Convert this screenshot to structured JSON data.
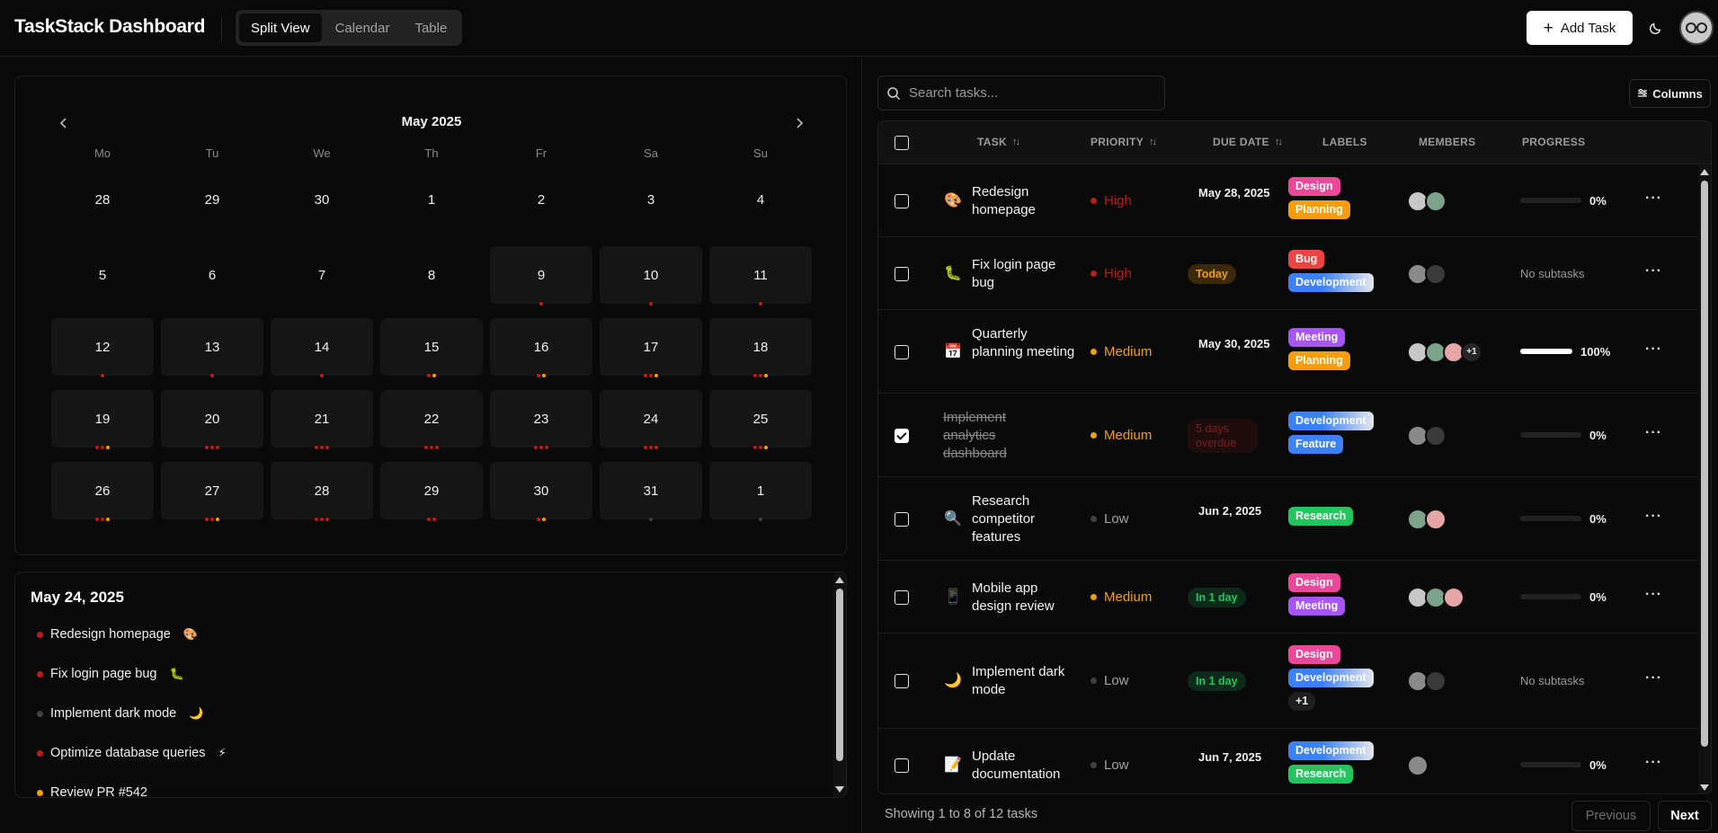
{
  "app": {
    "title": "TaskStack Dashboard"
  },
  "views": [
    "Split View",
    "Calendar",
    "Table"
  ],
  "active_view": "Split View",
  "header": {
    "add_task_label": "Add Task"
  },
  "colors": {
    "high": "#b91c1c",
    "medium": "#f59e0b",
    "low": "#3f3f46",
    "design": "#ec4899",
    "planning": "#f59e0b",
    "bug": "#ef4444",
    "development": "#3b82f6",
    "meeting": "#a855f7",
    "feature": "#3b82f6",
    "research": "#22c55e"
  },
  "calendar": {
    "month": "May 2025",
    "weekdays": [
      "Mo",
      "Tu",
      "We",
      "Th",
      "Fr",
      "Sa",
      "Su"
    ],
    "weeks": [
      [
        {
          "d": "28"
        },
        {
          "d": "29"
        },
        {
          "d": "30"
        },
        {
          "d": "1"
        },
        {
          "d": "2"
        },
        {
          "d": "3"
        },
        {
          "d": "4"
        }
      ],
      [
        {
          "d": "5"
        },
        {
          "d": "6"
        },
        {
          "d": "7"
        },
        {
          "d": "8"
        },
        {
          "d": "9",
          "bg": true,
          "dots": [
            "h"
          ]
        },
        {
          "d": "10",
          "bg": true,
          "dots": [
            "h"
          ]
        },
        {
          "d": "11",
          "bg": true,
          "dots": [
            "h"
          ]
        }
      ],
      [
        {
          "d": "12",
          "bg": true,
          "dots": [
            "h"
          ]
        },
        {
          "d": "13",
          "bg": true,
          "dots": [
            "h"
          ]
        },
        {
          "d": "14",
          "bg": true,
          "dots": [
            "h"
          ]
        },
        {
          "d": "15",
          "bg": true,
          "dots": [
            "h",
            "m"
          ]
        },
        {
          "d": "16",
          "bg": true,
          "dots": [
            "h",
            "m"
          ]
        },
        {
          "d": "17",
          "bg": true,
          "dots": [
            "h",
            "h",
            "m"
          ]
        },
        {
          "d": "18",
          "bg": true,
          "dots": [
            "h",
            "h",
            "m"
          ]
        }
      ],
      [
        {
          "d": "19",
          "bg": true,
          "dots": [
            "h",
            "h",
            "m"
          ]
        },
        {
          "d": "20",
          "bg": true,
          "dots": [
            "h",
            "h",
            "h"
          ]
        },
        {
          "d": "21",
          "bg": true,
          "dots": [
            "h",
            "h",
            "h"
          ]
        },
        {
          "d": "22",
          "bg": true,
          "dots": [
            "h",
            "h",
            "h"
          ]
        },
        {
          "d": "23",
          "bg": true,
          "dots": [
            "h",
            "h",
            "h"
          ]
        },
        {
          "d": "24",
          "bg": true,
          "dots": [
            "h",
            "h",
            "h"
          ]
        },
        {
          "d": "25",
          "bg": true,
          "dots": [
            "h",
            "h",
            "m"
          ]
        }
      ],
      [
        {
          "d": "26",
          "bg": true,
          "dots": [
            "h",
            "h",
            "m"
          ]
        },
        {
          "d": "27",
          "bg": true,
          "dots": [
            "h",
            "h",
            "m"
          ]
        },
        {
          "d": "28",
          "bg": true,
          "dots": [
            "h",
            "h",
            "h"
          ]
        },
        {
          "d": "29",
          "bg": true,
          "dots": [
            "h",
            "h"
          ]
        },
        {
          "d": "30",
          "bg": true,
          "dots": [
            "h",
            "m"
          ]
        },
        {
          "d": "31",
          "bg": true,
          "dots": [
            "l"
          ]
        },
        {
          "d": "1",
          "bg": true,
          "dots": [
            "l"
          ]
        }
      ]
    ]
  },
  "day_panel": {
    "date": "May 24, 2025",
    "items": [
      {
        "title": "Redesign homepage",
        "emoji": "🎨",
        "priority": "h"
      },
      {
        "title": "Fix login page bug",
        "emoji": "🐛",
        "priority": "h"
      },
      {
        "title": "Implement dark mode",
        "emoji": "🌙",
        "priority": "l"
      },
      {
        "title": "Optimize database queries",
        "emoji": "⚡",
        "priority": "h"
      },
      {
        "title": "Review PR #542",
        "emoji": "",
        "priority": "m"
      }
    ]
  },
  "table": {
    "search_placeholder": "Search tasks...",
    "columns_label": "Columns",
    "headers": {
      "task": "TASK",
      "priority": "PRIORITY",
      "due": "DUE DATE",
      "labels": "LABELS",
      "members": "MEMBERS",
      "progress": "PROGRESS"
    },
    "rows": [
      {
        "title": "Redesign homepage",
        "emoji": "🎨",
        "done": false,
        "priority": "High",
        "pk": "h",
        "due": "May 28, 2025",
        "due_type": "date",
        "labels": [
          [
            "Design",
            "design"
          ],
          [
            "Planning",
            "planning"
          ]
        ],
        "members": [
          "#c7c7c7",
          "#7ca38a"
        ],
        "more": "",
        "progress": 0,
        "progress_text": "0%"
      },
      {
        "title": "Fix login page bug",
        "emoji": "🐛",
        "done": false,
        "priority": "High",
        "pk": "h",
        "due": "Today",
        "due_type": "today",
        "labels": [
          [
            "Bug",
            "bug"
          ],
          [
            "Development",
            "development"
          ]
        ],
        "members": [
          "#8a8a8a",
          "#3a3a3a"
        ],
        "more": "",
        "progress": null,
        "progress_text": "No subtasks"
      },
      {
        "title": "Quarterly planning meeting",
        "emoji": "📅",
        "done": false,
        "priority": "Medium",
        "pk": "m",
        "due": "May 30, 2025",
        "due_type": "date",
        "labels": [
          [
            "Meeting",
            "meeting"
          ],
          [
            "Planning",
            "planning"
          ]
        ],
        "members": [
          "#c7c7c7",
          "#7ca38a",
          "#e6a6a6"
        ],
        "more": "+1",
        "progress": 1,
        "progress_text": "100%"
      },
      {
        "title": "Implement analytics dashboard",
        "emoji": "",
        "done": true,
        "priority": "Medium",
        "pk": "m",
        "due": "5 days overdue",
        "due_type": "overdue",
        "labels": [
          [
            "Development",
            "development"
          ],
          [
            "Feature",
            "feature"
          ]
        ],
        "members": [
          "#8a8a8a",
          "#3a3a3a"
        ],
        "more": "",
        "progress": 0,
        "progress_text": "0%"
      },
      {
        "title": "Research competitor features",
        "emoji": "🔍",
        "done": false,
        "priority": "Low",
        "pk": "l",
        "due": "Jun 2, 2025",
        "due_type": "date",
        "labels": [
          [
            "Research",
            "research"
          ]
        ],
        "members": [
          "#7ca38a",
          "#e6a6a6"
        ],
        "more": "",
        "progress": 0,
        "progress_text": "0%"
      },
      {
        "title": "Mobile app design review",
        "emoji": "📱",
        "done": false,
        "priority": "Medium",
        "pk": "m",
        "due": "In 1 day",
        "due_type": "soon",
        "labels": [
          [
            "Design",
            "design"
          ],
          [
            "Meeting",
            "meeting"
          ]
        ],
        "members": [
          "#c7c7c7",
          "#7ca38a",
          "#e6a6a6"
        ],
        "more": "",
        "progress": 0,
        "progress_text": "0%"
      },
      {
        "title": "Implement dark mode",
        "emoji": "🌙",
        "done": false,
        "priority": "Low",
        "pk": "l",
        "due": "In 1 day",
        "due_type": "soon",
        "labels": [
          [
            "Design",
            "design"
          ],
          [
            "Development",
            "development"
          ],
          [
            "+1",
            "more"
          ]
        ],
        "members": [
          "#8a8a8a",
          "#3a3a3a"
        ],
        "more": "",
        "progress": null,
        "progress_text": "No subtasks"
      },
      {
        "title": "Update documentation",
        "emoji": "📝",
        "done": false,
        "priority": "Low",
        "pk": "l",
        "due": "Jun 7, 2025",
        "due_type": "date",
        "labels": [
          [
            "Development",
            "development"
          ],
          [
            "Research",
            "research"
          ]
        ],
        "members": [
          "#8a8a8a"
        ],
        "more": "",
        "progress": 0,
        "progress_text": "0%"
      }
    ]
  },
  "footer": {
    "summary": "Showing 1 to 8 of 12 tasks",
    "prev_label": "Previous",
    "next_label": "Next"
  }
}
